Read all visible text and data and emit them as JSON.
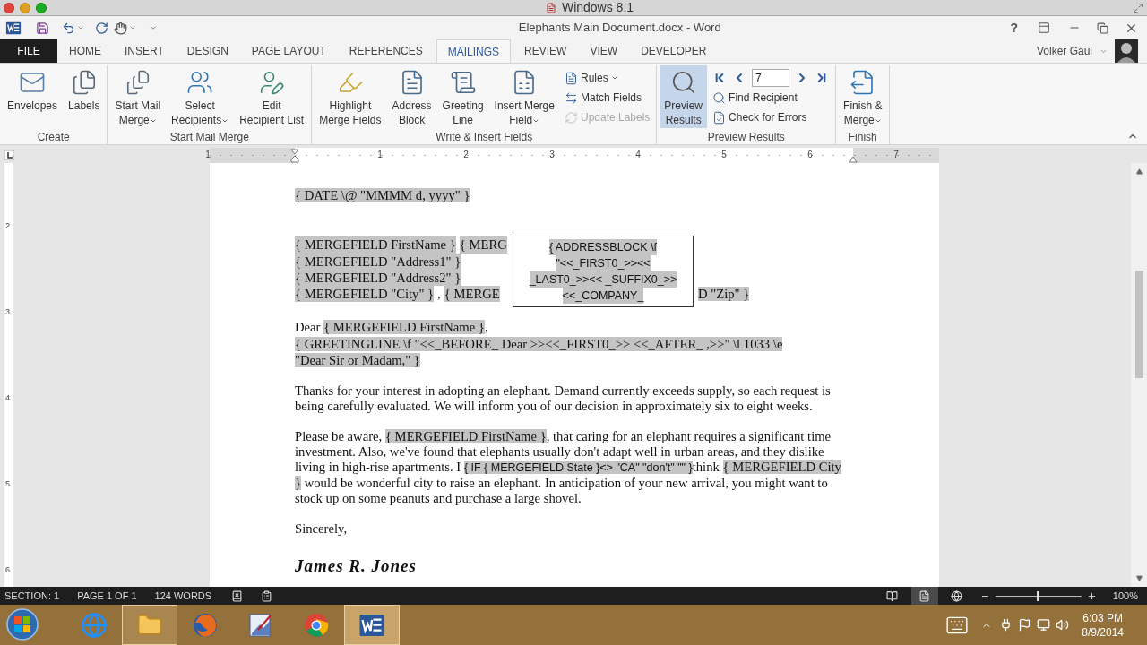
{
  "host_window": {
    "title": "Windows 8.1"
  },
  "window": {
    "title": "Elephants Main Document.docx - Word",
    "help": "?"
  },
  "tabs": [
    {
      "label": "FILE",
      "kind": "file",
      "selected": false
    },
    {
      "label": "HOME",
      "kind": "tab",
      "selected": false
    },
    {
      "label": "INSERT",
      "kind": "tab",
      "selected": false
    },
    {
      "label": "DESIGN",
      "kind": "tab",
      "selected": false
    },
    {
      "label": "PAGE LAYOUT",
      "kind": "tab",
      "selected": false
    },
    {
      "label": "REFERENCES",
      "kind": "tab",
      "selected": false
    },
    {
      "label": "MAILINGS",
      "kind": "tab",
      "selected": true
    },
    {
      "label": "REVIEW",
      "kind": "tab",
      "selected": false
    },
    {
      "label": "VIEW",
      "kind": "tab",
      "selected": false
    },
    {
      "label": "DEVELOPER",
      "kind": "tab",
      "selected": false
    }
  ],
  "user": {
    "name": "Volker Gaul"
  },
  "ribbon": {
    "groups": [
      {
        "label": "Create",
        "items": [
          {
            "kind": "large",
            "label": "Envelopes",
            "dropdown": false,
            "pressed": false
          },
          {
            "kind": "large",
            "label": "Labels",
            "dropdown": false,
            "pressed": false
          }
        ]
      },
      {
        "label": "Start Mail Merge",
        "items": [
          {
            "kind": "large",
            "label": "Start Mail\nMerge",
            "dropdown": true,
            "pressed": false
          },
          {
            "kind": "large",
            "label": "Select\nRecipients",
            "dropdown": true,
            "pressed": false
          },
          {
            "kind": "large",
            "label": "Edit\nRecipient List",
            "dropdown": false,
            "pressed": false
          }
        ]
      },
      {
        "label": "Write & Insert Fields",
        "items": [
          {
            "kind": "large",
            "label": "Highlight\nMerge Fields",
            "dropdown": false,
            "pressed": false
          },
          {
            "kind": "large",
            "label": "Address\nBlock",
            "dropdown": false,
            "pressed": false
          },
          {
            "kind": "large",
            "label": "Greeting\nLine",
            "dropdown": false,
            "pressed": false
          },
          {
            "kind": "large",
            "label": "Insert Merge\nField",
            "dropdown": true,
            "pressed": false
          },
          {
            "kind": "stack",
            "items": [
              {
                "kind": "small",
                "label": "Rules",
                "dropdown": true,
                "disabled": false
              },
              {
                "kind": "small",
                "label": "Match Fields",
                "dropdown": false,
                "disabled": false
              },
              {
                "kind": "small",
                "label": "Update Labels",
                "dropdown": false,
                "disabled": true
              }
            ]
          }
        ]
      },
      {
        "label": "Preview Results",
        "items": [
          {
            "kind": "large",
            "label": "Preview\nResults",
            "dropdown": false,
            "pressed": true
          },
          {
            "kind": "stack",
            "items": [
              {
                "kind": "nav",
                "record": "7"
              },
              {
                "kind": "small",
                "label": "Find Recipient",
                "dropdown": false,
                "disabled": false
              },
              {
                "kind": "small",
                "label": "Check for Errors",
                "dropdown": false,
                "disabled": false
              }
            ]
          }
        ]
      },
      {
        "label": "Finish",
        "items": [
          {
            "kind": "large",
            "label": "Finish &\nMerge",
            "dropdown": true,
            "pressed": false
          }
        ]
      }
    ]
  },
  "ruler": {
    "numbers": [
      "1",
      "1",
      "2",
      "3",
      "4",
      "5",
      "6",
      "7"
    ]
  },
  "vertical_ruler": {
    "numbers": [
      "2",
      "3",
      "4",
      "5",
      "6"
    ]
  },
  "document": {
    "blocks": [
      {
        "kind": "date",
        "runs": [
          {
            "kind": "field",
            "text": "{ DATE \\@ \"MMMM d, yyyy\" }"
          }
        ]
      },
      {
        "kind": "address",
        "lines": [
          [
            {
              "kind": "field",
              "text": "{ MERGEFIELD FirstName }"
            },
            {
              "kind": "field",
              "text": "{ MERG"
            }
          ],
          [
            {
              "kind": "field",
              "text": "{ MERGEFIELD \"Address1\" }"
            }
          ],
          [
            {
              "kind": "field",
              "text": "{ MERGEFIELD \"Address2\" }"
            }
          ],
          [
            {
              "kind": "field",
              "text": "{ MERGEFIELD \"City\" }"
            },
            {
              "kind": "plain",
              "text": ", "
            },
            {
              "kind": "field",
              "text": "{ MERGE"
            },
            {
              "kind": "field",
              "text": "D \"Zip\" }",
              "after_box": true
            }
          ]
        ],
        "preview": {
          "lines": [
            "{ ADDRESSBLOCK \\f",
            "\"<<_FIRST0_>><<",
            "_LAST0_>><< _SUFFIX0_>>",
            "<<_COMPANY_"
          ]
        }
      },
      {
        "kind": "salutation",
        "runs": [
          {
            "kind": "plain",
            "text": "Dear "
          },
          {
            "kind": "field",
            "text": "{ MERGEFIELD FirstName }"
          },
          {
            "kind": "plain",
            "text": ","
          }
        ]
      },
      {
        "kind": "greeting",
        "runs": [
          {
            "kind": "field",
            "text": "{ GREETINGLINE \\f \"<<_BEFORE_ Dear >><<_FIRST0_>> <<_AFTER_ ,>>\" \\l 1033 \\e \"Dear Sir or Madam,\" }"
          }
        ]
      },
      {
        "kind": "body",
        "runs": [
          {
            "kind": "plain",
            "text": "Thanks for your interest in adopting an elephant. Demand currently exceeds supply, so each request is being carefully evaluated. We will inform you of our decision in approximately six to eight weeks."
          }
        ]
      },
      {
        "kind": "body",
        "runs": [
          {
            "kind": "plain",
            "text": "Please be aware, "
          },
          {
            "kind": "field",
            "text": "{ MERGEFIELD FirstName }"
          },
          {
            "kind": "plain",
            "text": ", that caring for an elephant requires a significant time investment. Also, we've found that elephants usually don't adapt well in urban areas, and they dislike living in high-rise apartments. I "
          },
          {
            "kind": "field-sans",
            "text": "{ IF { MERGEFIELD State }<> \"CA\" \"don't\" \"\" }"
          },
          {
            "kind": "plain",
            "text": "think "
          },
          {
            "kind": "field",
            "text": "{ MERGEFIELD City }"
          },
          {
            "kind": "plain",
            "text": " would be wonderful city to raise an elephant. In anticipation of your new arrival, you might want to stock up on some peanuts and purchase a large shovel."
          }
        ]
      },
      {
        "kind": "closing",
        "runs": [
          {
            "kind": "plain",
            "text": "Sincerely,"
          }
        ]
      },
      {
        "kind": "signature",
        "runs": [
          {
            "kind": "plain",
            "text": "James R. Jones"
          }
        ]
      }
    ]
  },
  "status_bar": {
    "section": "SECTION: 1",
    "page": "PAGE 1 OF 1",
    "words": "124 WORDS",
    "views": [
      {
        "selected": false
      },
      {
        "selected": true
      },
      {
        "selected": false
      }
    ],
    "zoom": {
      "level": 0.5,
      "reading": "100%"
    }
  },
  "taskbar": {
    "apps": [
      {
        "running": false,
        "selected": false
      },
      {
        "running": true,
        "selected": false
      },
      {
        "running": false,
        "selected": false
      },
      {
        "running": false,
        "selected": false
      },
      {
        "running": false,
        "selected": false
      },
      {
        "running": true,
        "selected": true
      }
    ],
    "time": "6:03 PM",
    "date": "8/9/2014"
  }
}
